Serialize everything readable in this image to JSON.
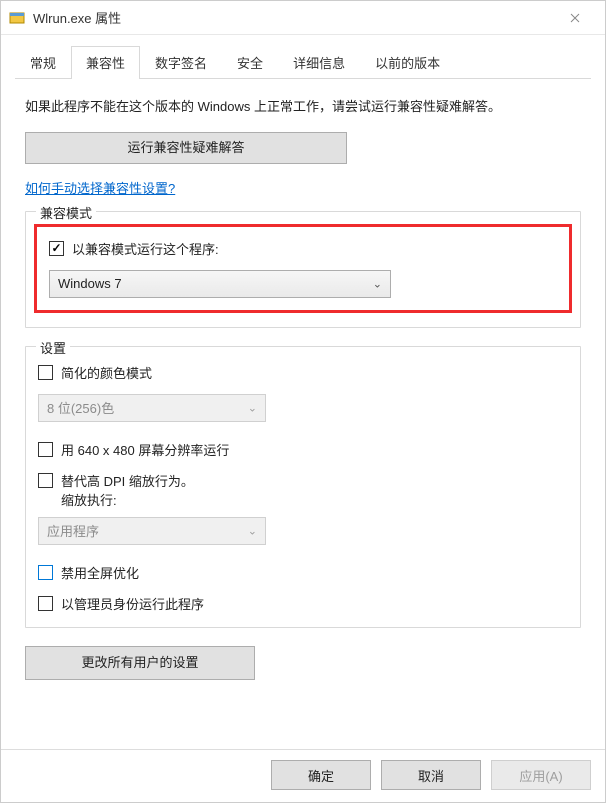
{
  "window": {
    "title": "Wlrun.exe 属性"
  },
  "tabs": {
    "general": "常规",
    "compatibility": "兼容性",
    "signature": "数字签名",
    "security": "安全",
    "details": "详细信息",
    "previous": "以前的版本"
  },
  "intro": "如果此程序不能在这个版本的 Windows 上正常工作，请尝试运行兼容性疑难解答。",
  "troubleshoot_btn": "运行兼容性疑难解答",
  "manual_link": "如何手动选择兼容性设置?",
  "compat_mode": {
    "group_title": "兼容模式",
    "run_label": "以兼容模式运行这个程序:",
    "selected": "Windows 7"
  },
  "settings": {
    "group_title": "设置",
    "reduced_color": "简化的颜色模式",
    "color_value": "8 位(256)色",
    "low_res": "用 640 x 480 屏幕分辨率运行",
    "dpi_override1": "替代高 DPI 缩放行为。",
    "dpi_override2": "缩放执行:",
    "dpi_value": "应用程序",
    "disable_fullscreen": "禁用全屏优化",
    "run_admin": "以管理员身份运行此程序"
  },
  "change_all_btn": "更改所有用户的设置",
  "footer": {
    "ok": "确定",
    "cancel": "取消",
    "apply": "应用(A)"
  }
}
